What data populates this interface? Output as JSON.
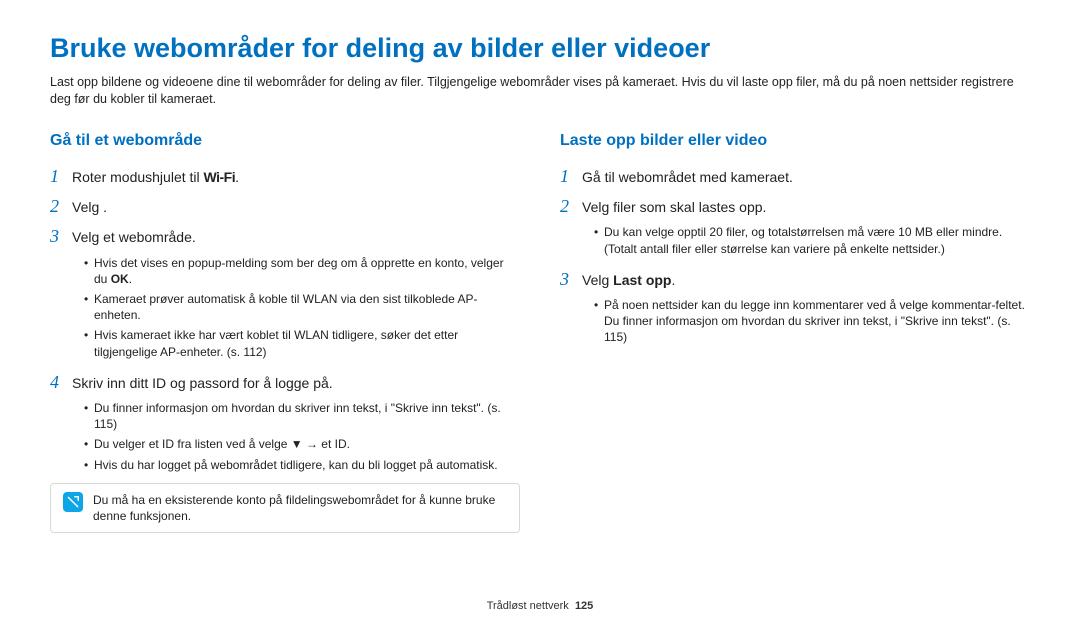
{
  "title": "Bruke webområder for deling av bilder eller videoer",
  "intro": "Last opp bildene og videoene dine til webområder for deling av filer. Tilgjengelige webområder vises på kameraet. Hvis du vil laste opp filer, må du på noen nettsider registrere deg før du kobler til kameraet.",
  "left": {
    "heading": "Gå til et webområde",
    "s1_pre": "Roter modushjulet til ",
    "s1_wifi": "Wi-Fi",
    "s1_post": ".",
    "s2": "Velg        .",
    "s3": "Velg et webområde.",
    "s3_b1_pre": "Hvis det vises en popup-melding som ber deg om å opprette en konto, velger du ",
    "s3_b1_bold": "OK",
    "s3_b1_post": ".",
    "s3_b2": "Kameraet prøver automatisk å koble til WLAN via den sist tilkoblede AP-enheten.",
    "s3_b3": "Hvis kameraet ikke har vært koblet til WLAN tidligere, søker det etter tilgjengelige AP-enheter. (s. 112)",
    "s4": "Skriv inn ditt ID og passord for å logge på.",
    "s4_b1": "Du finner informasjon om hvordan du skriver inn tekst, i \"Skrive inn tekst\". (s. 115)",
    "s4_b2": "Du velger et ID fra listen ved å velge ▼ → et ID.",
    "s4_b3": "Hvis du har logget på webområdet tidligere, kan du bli logget på automatisk.",
    "note": "Du må ha en eksisterende konto på fildelingswebområdet for å kunne bruke denne funksjonen."
  },
  "right": {
    "heading": "Laste opp bilder eller video",
    "s1": "Gå til webområdet med kameraet.",
    "s2": "Velg filer som skal lastes opp.",
    "s2_b1": "Du kan velge opptil 20 filer, og totalstørrelsen må være 10 MB eller mindre. (Totalt antall filer eller størrelse kan variere på enkelte nettsider.)",
    "s3_pre": "Velg ",
    "s3_bold": "Last opp",
    "s3_post": ".",
    "s3_b1": "På noen nettsider kan du legge inn kommentarer ved å velge kommentar-feltet. Du finner informasjon om hvordan du skriver inn tekst, i \"Skrive inn tekst\". (s. 115)"
  },
  "footer_label": "Trådløst nettverk",
  "footer_page": "125"
}
